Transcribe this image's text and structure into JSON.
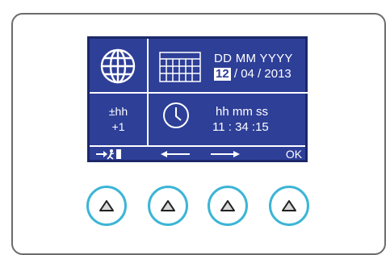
{
  "display": {
    "timezone": {
      "label": "±hh",
      "value": "+1"
    },
    "date": {
      "format": "DD MM YYYY",
      "day": "12",
      "rest": "/ 04 / 2013"
    },
    "time": {
      "format": "hh  mm  ss",
      "value": "11 : 34 :15"
    },
    "softkeys": {
      "ok": "OK",
      "icons": [
        "exit-icon",
        "arrow-left-icon",
        "arrow-right-icon"
      ]
    }
  },
  "buttons": [
    "triangle-icon",
    "triangle-icon",
    "triangle-icon",
    "triangle-icon"
  ],
  "colors": {
    "lcd": "#2e3f98",
    "button_ring": "#3cb5d6",
    "frame": "#6b6b6b"
  }
}
